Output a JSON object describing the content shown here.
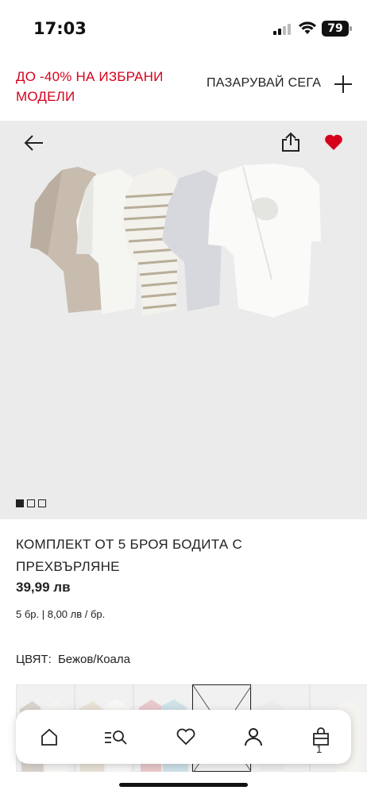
{
  "status_bar": {
    "time": "17:03",
    "battery": "79"
  },
  "promo": {
    "text": "ДО -40% НА ИЗБРАНИ МОДЕЛИ",
    "shop_label": "ПАЗАРУВАЙ СЕГА",
    "accent_color": "#d6001c"
  },
  "hero": {
    "back_icon": "arrow-left-icon",
    "share_icon": "share-icon",
    "favorite_icon": "heart-filled-icon",
    "favorite_color": "#d6001c",
    "image_count": 3,
    "active_image": 1
  },
  "product": {
    "title": "КОМПЛЕКТ ОТ 5 БРОЯ БОДИТА С ПРЕХВЪРЛЯНЕ",
    "price": "39,99 лв",
    "unit_price": "5 бр. | 8,00 лв / бр.",
    "color_label": "ЦВЯТ:",
    "color_value": "Бежов/Коала"
  },
  "bottom_nav": {
    "items": [
      "home-icon",
      "search-filter-icon",
      "heart-icon",
      "account-icon",
      "bag-icon"
    ],
    "bag_count": "1"
  }
}
